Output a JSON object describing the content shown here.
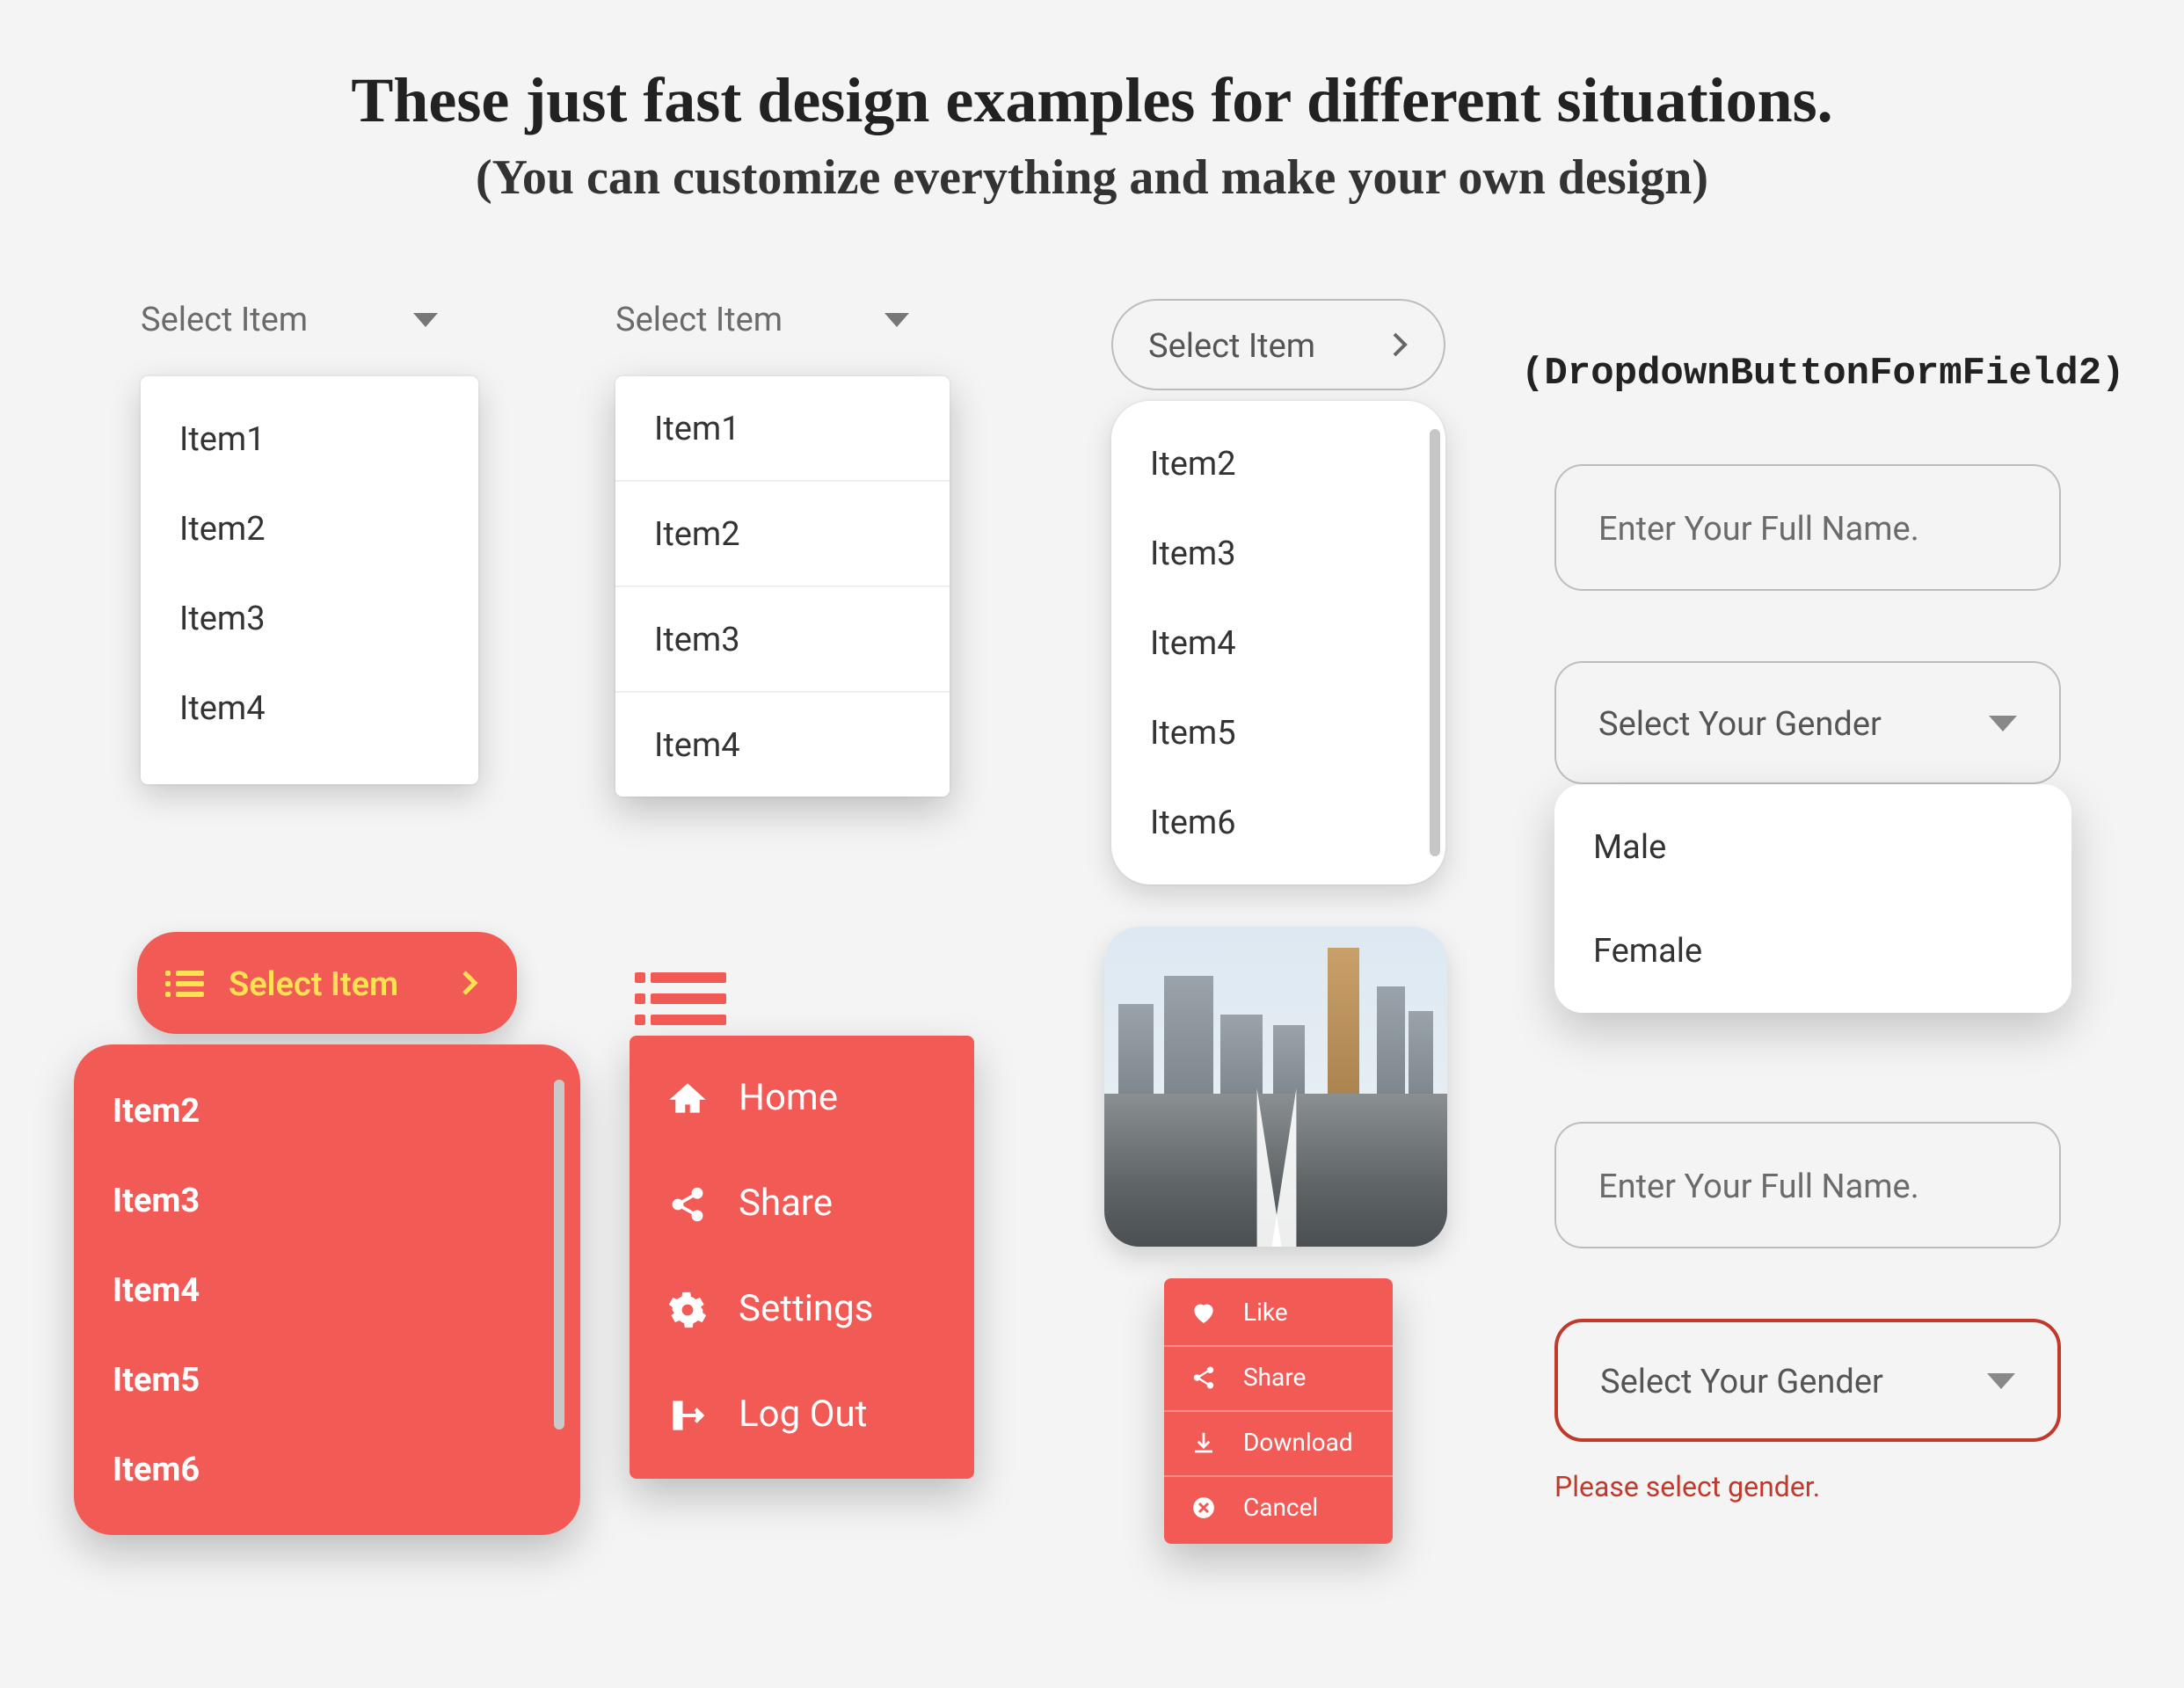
{
  "heading": {
    "title": "These just fast design examples for different situations.",
    "subtitle": "(You can customize everything and make your own design)"
  },
  "dd1": {
    "placeholder": "Select Item",
    "items": [
      "Item1",
      "Item2",
      "Item3",
      "Item4"
    ]
  },
  "dd2": {
    "placeholder": "Select Item",
    "items": [
      "Item1",
      "Item2",
      "Item3",
      "Item4"
    ]
  },
  "dd3": {
    "placeholder": "Select Item",
    "items": [
      "Item2",
      "Item3",
      "Item4",
      "Item5",
      "Item6"
    ]
  },
  "dd4": {
    "button_label": "Select Item",
    "items": [
      "Item2",
      "Item3",
      "Item4",
      "Item5",
      "Item6"
    ]
  },
  "dd5": {
    "items": [
      {
        "icon": "home",
        "label": "Home"
      },
      {
        "icon": "share",
        "label": "Share"
      },
      {
        "icon": "settings",
        "label": "Settings"
      },
      {
        "icon": "logout",
        "label": "Log Out"
      }
    ]
  },
  "dd6": {
    "items": [
      {
        "icon": "heart",
        "label": "Like"
      },
      {
        "icon": "share",
        "label": "Share"
      },
      {
        "icon": "download",
        "label": "Download"
      },
      {
        "icon": "cancel",
        "label": "Cancel"
      }
    ]
  },
  "form_title": "(DropdownButtonFormField2)",
  "dd7": {
    "name_placeholder": "Enter Your Full Name.",
    "gender_placeholder": "Select Your Gender",
    "options": [
      "Male",
      "Female"
    ]
  },
  "dd8": {
    "name_placeholder": "Enter Your Full Name.",
    "gender_placeholder": "Select Your Gender",
    "validation": "Please select gender."
  },
  "colors": {
    "accent": "#f25a56",
    "accent_text": "#ffe153",
    "error": "#c1392b"
  }
}
